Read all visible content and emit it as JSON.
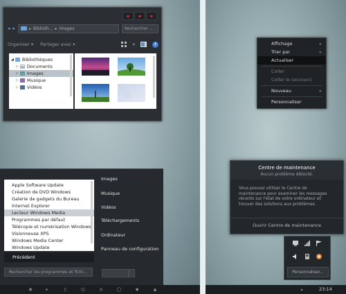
{
  "explorer": {
    "address_segments": [
      "Biblioth...",
      "Images"
    ],
    "search_placeholder": "Rechercher ...",
    "toolbar": {
      "organize": "Organiser",
      "share": "Partager avec"
    },
    "nav_items": [
      {
        "label": "Bibliothèques",
        "level": 0
      },
      {
        "label": "Documents",
        "level": 1
      },
      {
        "label": "Images",
        "level": 1,
        "selected": true
      },
      {
        "label": "Musique",
        "level": 1
      },
      {
        "label": "Vidéos",
        "level": 1
      }
    ]
  },
  "context_menu": {
    "items": [
      {
        "label": "Affichage",
        "submenu": true,
        "disabled": false
      },
      {
        "label": "Trier par",
        "submenu": true,
        "disabled": false
      },
      {
        "label": "Actualiser",
        "highlighted": true,
        "disabled": false
      },
      {
        "label": "Coller",
        "disabled": true
      },
      {
        "label": "Coller le raccourci",
        "disabled": true
      },
      {
        "label": "Nouveau",
        "submenu": true,
        "disabled": false
      },
      {
        "label": "Personnaliser",
        "disabled": false
      }
    ]
  },
  "start_menu": {
    "programs": [
      "Apple Software Update",
      "Création de DVD Windows",
      "Galerie de gadgets du Bureau",
      "Internet Explorer",
      "Lecteur Windows Media",
      "Programmes par défaut",
      "Télécopie et numérisation Windows",
      "Visionneuse XPS",
      "Windows Media Center",
      "Windows Update"
    ],
    "selected_program": "Lecteur Windows Media",
    "back_label": "Précédent",
    "search_placeholder": "Rechercher les programmes et fichi...",
    "right_items": [
      "Images",
      "Musique",
      "Vidéos",
      "Téléchargements",
      "Ordinateur",
      "Panneau de configuration"
    ]
  },
  "action_center": {
    "title": "Centre de maintenance",
    "subtitle": "Aucun problème détecté.",
    "body": "Vous pouvez utiliser le Centre de maintenance pour examiner les messages récents sur l'état de votre ordinateur et trouver des solutions aux problèmes.",
    "link": "Ouvrir Centre de maintenance"
  },
  "tray": {
    "customize_label": "Personnaliser..."
  },
  "taskbar": {
    "clock": "23:14"
  }
}
